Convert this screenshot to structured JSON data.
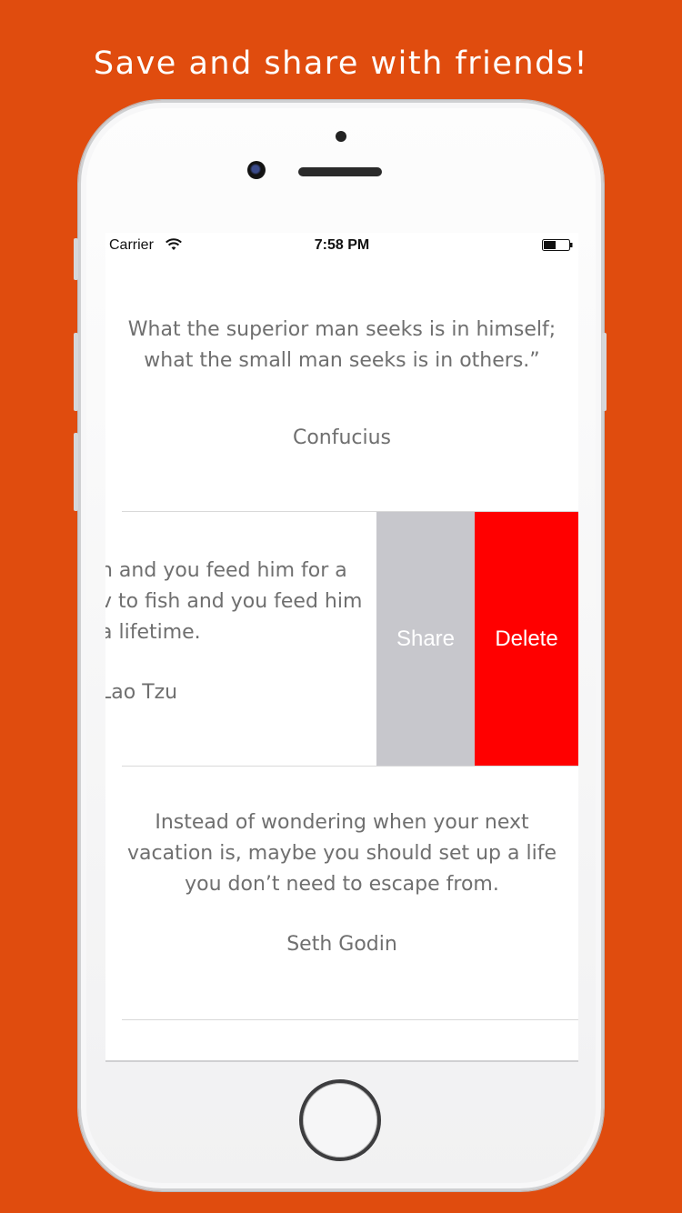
{
  "headline": "Save and share with friends!",
  "status_bar": {
    "carrier": "Carrier",
    "time": "7:58 PM",
    "wifi_icon": "wifi-icon",
    "battery_icon": "battery-icon"
  },
  "quotes": [
    {
      "lines": [
        "What the superior man seeks is in himself;",
        "what the small man seeks is in others.”"
      ],
      "author": "Confucius"
    },
    {
      "lines": [
        "n and you feed him for a",
        "v to fish and you feed him",
        "a lifetime."
      ],
      "author": "Lao Tzu"
    },
    {
      "lines": [
        "Instead of wondering when your next",
        "vacation is, maybe you should set up a life",
        "you don’t need to escape from."
      ],
      "author": "Seth Godin"
    }
  ],
  "swipe_actions": {
    "share_label": "Share",
    "delete_label": "Delete",
    "share_color": "#c7c7cc",
    "delete_color": "#ff0000"
  },
  "colors": {
    "background": "#e04c0e",
    "quote_text": "#6f6f6f"
  }
}
